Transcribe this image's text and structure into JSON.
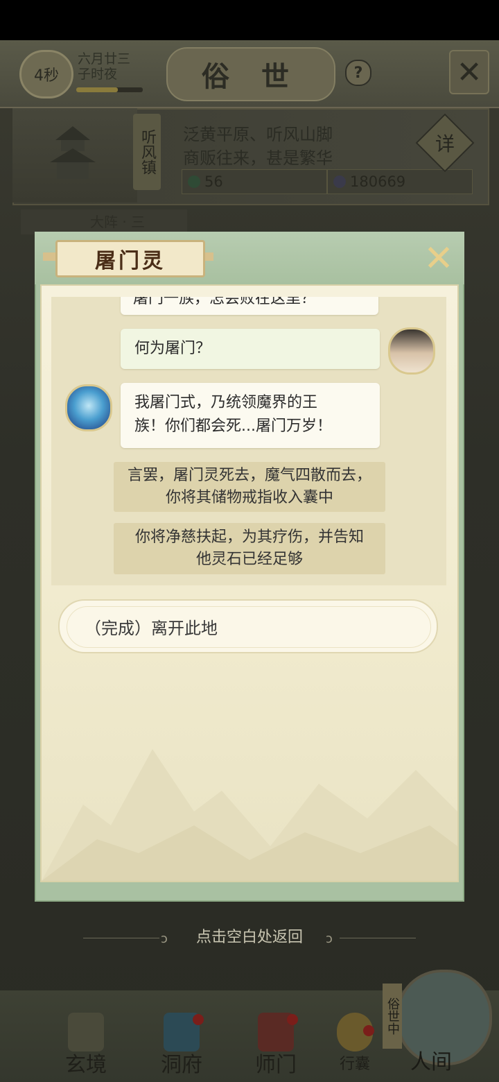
{
  "header": {
    "timer": "4秒",
    "date_line1": "六月廿三",
    "date_line2": "子时夜",
    "title": "俗 世",
    "help": "?"
  },
  "location": {
    "town": "听风镇",
    "line1": "泛黄平原、听风山脚",
    "line2": "商贩往来，甚是繁华",
    "jade": "56",
    "coins": "180669",
    "detail": "详",
    "peek_tab": "大阵 · 三"
  },
  "dialog": {
    "title": "屠门灵",
    "chat": {
      "cut_line": "屠门一族，怎会败在这里？",
      "player_msg": "何为屠门？",
      "npc_msg_line1": "我屠门式，乃统领魔界的王",
      "npc_msg_line2": "族！你们都会死...屠门万岁！",
      "narration1_line1": "言罢，屠门灵死去，魔气四散而去，",
      "narration1_line2": "你将其储物戒指收入囊中",
      "narration2_line1": "你将净慈扶起，为其疗伤，并告知",
      "narration2_line2": "他灵石已经足够"
    },
    "option": "（完成）离开此地"
  },
  "hint": "点击空白处返回",
  "nav": {
    "items": [
      "玄境",
      "洞府",
      "师门",
      "行囊",
      "人间"
    ],
    "world_seal": "俗世中"
  },
  "colors": {
    "dialog_frame": "#a9c1a2",
    "paper": "#f6f1dc",
    "title_text": "#4a2d17"
  }
}
